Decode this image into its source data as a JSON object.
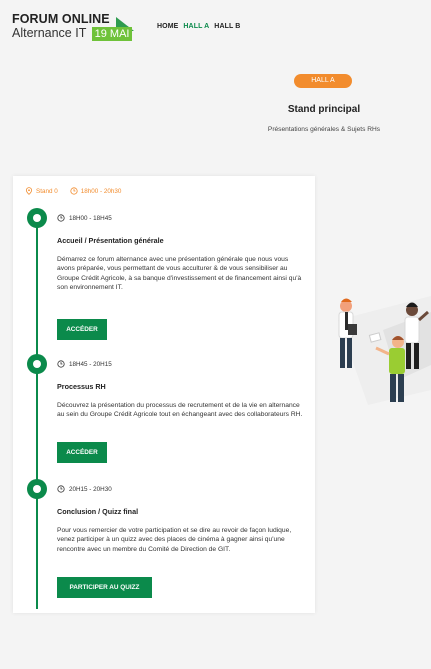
{
  "header": {
    "logo_title": "FORUM ONLINE",
    "logo_subtitle": "Alternance IT",
    "logo_badge": "19 MAI",
    "nav": [
      {
        "label": "HOME",
        "active": false
      },
      {
        "label": "HALL A",
        "active": true
      },
      {
        "label": "HALL B",
        "active": false
      }
    ]
  },
  "hall": {
    "pill": "HALL A",
    "title": "Stand principal",
    "subtitle": "Présentations générales & Sujets RHs"
  },
  "card": {
    "stand": "Stand 0",
    "time_range": "18h00 - 20h30",
    "sessions": [
      {
        "time": "18H00 - 18H45",
        "title": "Accueil / Présentation générale",
        "desc": "Démarrez ce forum alternance avec une présentation générale que nous vous avons préparée, vous permettant de vous acculturer & de vous sensibiliser au Groupe Crédit Agricole, à sa banque d'investissement et de financement ainsi qu'à son environnement IT.",
        "button": "ACCÉDER"
      },
      {
        "time": "18H45 - 20H15",
        "title": "Processus RH",
        "desc": "Découvrez la présentation du processus de recrutement et de la vie en alternance au sein du Groupe Crédit Agricole tout en échangeant avec des collaborateurs RH.",
        "button": "ACCÉDER"
      },
      {
        "time": "20H15 - 20H30",
        "title": "Conclusion / Quizz final",
        "desc": "Pour vous remercier de votre participation et se dire au revoir de façon ludique, venez participer à un quizz avec des places de cinéma à gagner ainsi qu'une rencontre avec un membre du Comité de Direction de GIT.",
        "button": "PARTICIPER AU QUIZZ"
      }
    ]
  },
  "colors": {
    "accent_green": "#0b8a4b",
    "accent_orange": "#f28c2d",
    "logo_green": "#6fc23a"
  },
  "icons": [
    "location-pin-icon",
    "clock-icon",
    "timeline-dot-icon"
  ]
}
